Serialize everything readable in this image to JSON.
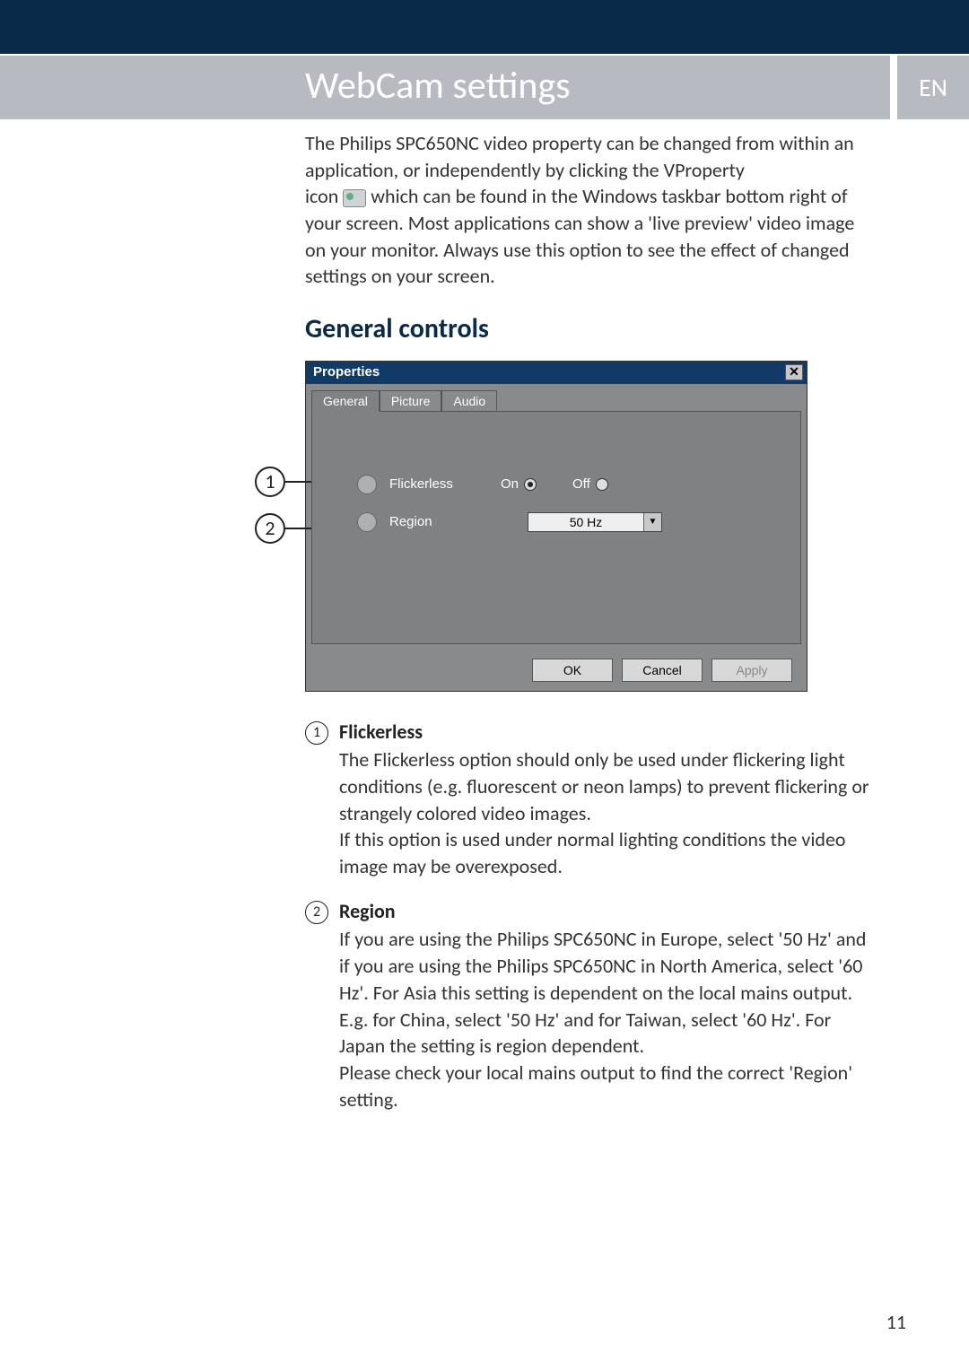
{
  "header": {
    "title": "WebCam settings",
    "lang": "EN"
  },
  "intro": {
    "line1": "The Philips SPC650NC video property can be changed from within an application, or independently by clicking the VProperty",
    "line2_prefix": "icon ",
    "line2_suffix": "which can be found in the Windows taskbar bottom right of your screen. Most applications can show a 'live preview' video image on your monitor. Always use this option to see the effect of changed settings on your screen."
  },
  "section_heading": "General controls",
  "dialog": {
    "title": "Properties",
    "tabs": {
      "general": "General",
      "picture": "Picture",
      "audio": "Audio"
    },
    "flickerless": {
      "label": "Flickerless",
      "on": "On",
      "off": "Off"
    },
    "region": {
      "label": "Region",
      "value": "50 Hz"
    },
    "buttons": {
      "ok": "OK",
      "cancel": "Cancel",
      "apply": "Apply"
    }
  },
  "callout": {
    "one": "1",
    "two": "2"
  },
  "items": {
    "one": {
      "num": "1",
      "title": "Flickerless",
      "body": "The Flickerless option should only be used under flickering light conditions (e.g. fluorescent or neon lamps) to prevent flickering or strangely colored video images.\nIf this option is used under normal lighting conditions the video image may be overexposed."
    },
    "two": {
      "num": "2",
      "title": "Region",
      "body": "If you are using the Philips SPC650NC in Europe, select '50 Hz' and if you are using the Philips SPC650NC in North America, select '60 Hz'. For Asia this setting is dependent on the local mains output. E.g. for China, select '50 Hz' and for Taiwan, select '60 Hz'. For Japan the setting is region dependent.\nPlease check your local mains output to find the correct 'Region' setting."
    }
  },
  "page_number": "11"
}
